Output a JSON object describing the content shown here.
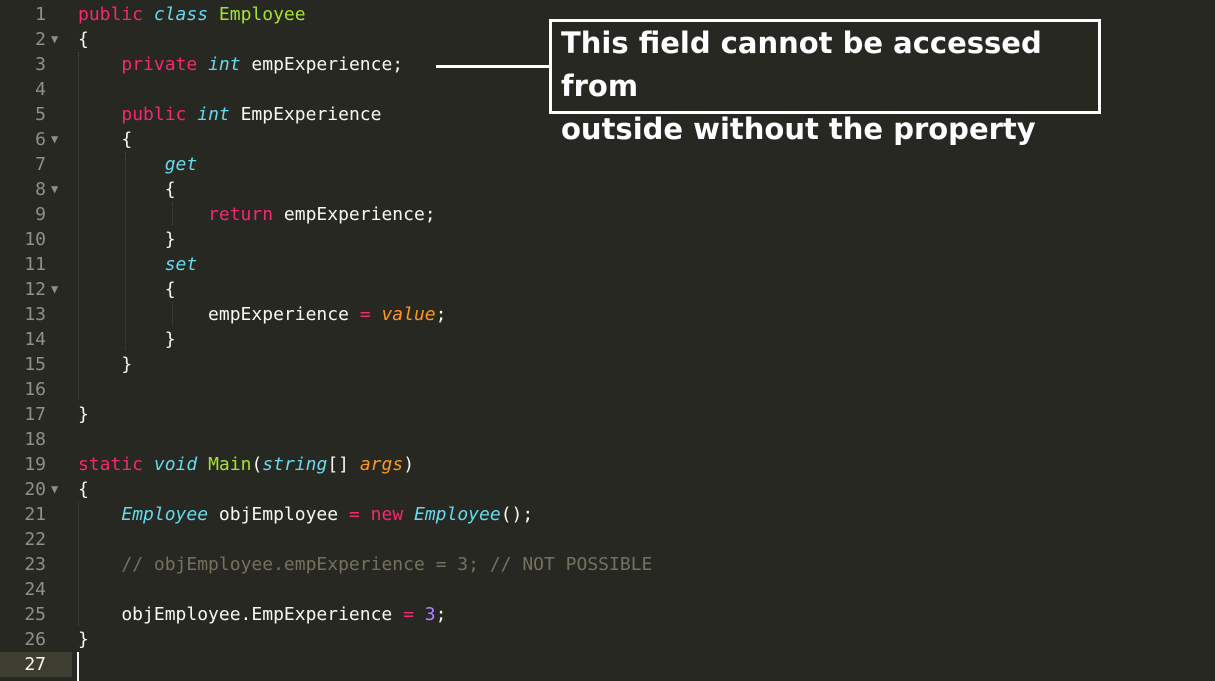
{
  "editor": {
    "current_line": 27,
    "lines": [
      {
        "n": "1",
        "fold": false,
        "tokens": [
          [
            "kw",
            "public"
          ],
          [
            "plain",
            " "
          ],
          [
            "type",
            "class"
          ],
          [
            "plain",
            " "
          ],
          [
            "cls",
            "Employee"
          ]
        ]
      },
      {
        "n": "2",
        "fold": true,
        "tokens": [
          [
            "plain",
            "{"
          ]
        ]
      },
      {
        "n": "3",
        "fold": false,
        "tokens": [
          [
            "plain",
            "    "
          ],
          [
            "kw",
            "private"
          ],
          [
            "plain",
            " "
          ],
          [
            "type",
            "int"
          ],
          [
            "plain",
            " empExperience;"
          ]
        ]
      },
      {
        "n": "4",
        "fold": false,
        "tokens": []
      },
      {
        "n": "5",
        "fold": false,
        "tokens": [
          [
            "plain",
            "    "
          ],
          [
            "kw",
            "public"
          ],
          [
            "plain",
            " "
          ],
          [
            "type",
            "int"
          ],
          [
            "plain",
            " EmpExperience"
          ]
        ]
      },
      {
        "n": "6",
        "fold": true,
        "tokens": [
          [
            "plain",
            "    {"
          ]
        ]
      },
      {
        "n": "7",
        "fold": false,
        "tokens": [
          [
            "plain",
            "        "
          ],
          [
            "type",
            "get"
          ]
        ]
      },
      {
        "n": "8",
        "fold": true,
        "tokens": [
          [
            "plain",
            "        {"
          ]
        ]
      },
      {
        "n": "9",
        "fold": false,
        "tokens": [
          [
            "plain",
            "            "
          ],
          [
            "kw",
            "return"
          ],
          [
            "plain",
            " empExperience;"
          ]
        ]
      },
      {
        "n": "10",
        "fold": false,
        "tokens": [
          [
            "plain",
            "        }"
          ]
        ]
      },
      {
        "n": "11",
        "fold": false,
        "tokens": [
          [
            "plain",
            "        "
          ],
          [
            "type",
            "set"
          ]
        ]
      },
      {
        "n": "12",
        "fold": true,
        "tokens": [
          [
            "plain",
            "        {"
          ]
        ]
      },
      {
        "n": "13",
        "fold": false,
        "tokens": [
          [
            "plain",
            "            empExperience "
          ],
          [
            "kw",
            "="
          ],
          [
            "plain",
            " "
          ],
          [
            "param",
            "value"
          ],
          [
            "plain",
            ";"
          ]
        ]
      },
      {
        "n": "14",
        "fold": false,
        "tokens": [
          [
            "plain",
            "        }"
          ]
        ]
      },
      {
        "n": "15",
        "fold": false,
        "tokens": [
          [
            "plain",
            "    }"
          ]
        ]
      },
      {
        "n": "16",
        "fold": false,
        "tokens": []
      },
      {
        "n": "17",
        "fold": false,
        "tokens": [
          [
            "plain",
            "}"
          ]
        ]
      },
      {
        "n": "18",
        "fold": false,
        "tokens": []
      },
      {
        "n": "19",
        "fold": false,
        "tokens": [
          [
            "kw",
            "static"
          ],
          [
            "plain",
            " "
          ],
          [
            "type",
            "void"
          ],
          [
            "plain",
            " "
          ],
          [
            "cls",
            "Main"
          ],
          [
            "plain",
            "("
          ],
          [
            "type",
            "string"
          ],
          [
            "plain",
            "[] "
          ],
          [
            "param",
            "args"
          ],
          [
            "plain",
            ")"
          ]
        ]
      },
      {
        "n": "20",
        "fold": true,
        "tokens": [
          [
            "plain",
            "{"
          ]
        ]
      },
      {
        "n": "21",
        "fold": false,
        "tokens": [
          [
            "plain",
            "    "
          ],
          [
            "type",
            "Employee"
          ],
          [
            "plain",
            " objEmployee "
          ],
          [
            "kw",
            "="
          ],
          [
            "plain",
            " "
          ],
          [
            "kw",
            "new"
          ],
          [
            "plain",
            " "
          ],
          [
            "type",
            "Employee"
          ],
          [
            "plain",
            "();"
          ]
        ]
      },
      {
        "n": "22",
        "fold": false,
        "tokens": []
      },
      {
        "n": "23",
        "fold": false,
        "tokens": [
          [
            "plain",
            "    "
          ],
          [
            "comment",
            "// objEmployee.empExperience = 3; // NOT POSSIBLE"
          ]
        ]
      },
      {
        "n": "24",
        "fold": false,
        "tokens": []
      },
      {
        "n": "25",
        "fold": false,
        "tokens": [
          [
            "plain",
            "    objEmployee.EmpExperience "
          ],
          [
            "kw",
            "="
          ],
          [
            "plain",
            " "
          ],
          [
            "num",
            "3"
          ],
          [
            "plain",
            ";"
          ]
        ]
      },
      {
        "n": "26",
        "fold": false,
        "tokens": [
          [
            "plain",
            "}"
          ]
        ]
      },
      {
        "n": "27",
        "fold": false,
        "tokens": []
      }
    ]
  },
  "callout": {
    "line1": "This field cannot be accessed from",
    "line2": "outside without the property"
  },
  "icons": {
    "fold": "fold-arrow-icon"
  },
  "colors": {
    "background": "#272822",
    "keyword": "#f92672",
    "type": "#66d9ef",
    "class_name": "#a6e22e",
    "parameter": "#fd971f",
    "number": "#ae81ff",
    "comment": "#75715e"
  }
}
